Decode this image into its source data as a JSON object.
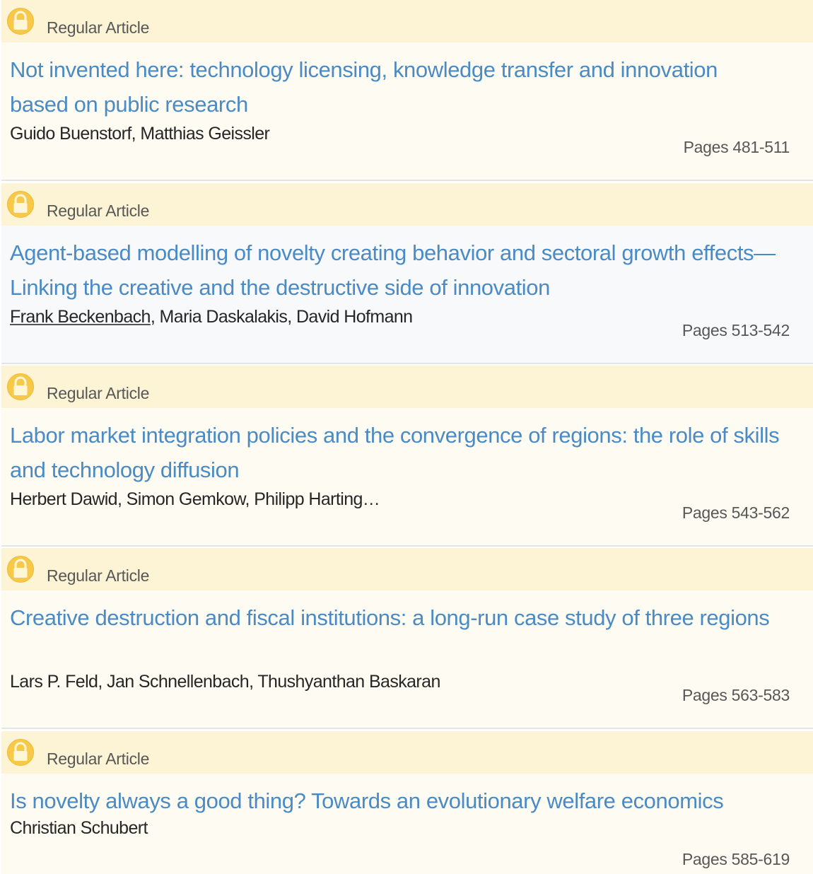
{
  "colors": {
    "header_background": "#fcf4d4",
    "item_background": "#fefcf2",
    "hovered_item_background": "#f8f9fb",
    "title_link": "#4a8ac5",
    "lock_icon": "#f7c94b",
    "divider": "#e4e4e4"
  },
  "articles": [
    {
      "type": "Regular Article",
      "title": "Not invented here: technology licensing, knowledge transfer and innovation based on public research",
      "authors": "Guido Buenstorf, Matthias Geissler",
      "pages": "Pages 481-511",
      "access_icon": "lock-icon"
    },
    {
      "type": "Regular Article",
      "title": "Agent-based modelling of novelty creating behavior and sectoral growth effects—Linking the creative and the destructive side of innovation",
      "authors_linked": "Frank Beckenbach",
      "authors_rest": ", Maria Daskalakis, David Hofmann",
      "pages": "Pages 513-542",
      "access_icon": "lock-icon"
    },
    {
      "type": "Regular Article",
      "title": "Labor market integration policies and the convergence of regions: the role of skills and technology diffusion",
      "authors": "Herbert Dawid, Simon Gemkow, Philipp Harting…",
      "pages": "Pages 543-562",
      "access_icon": "lock-icon"
    },
    {
      "type": "Regular Article",
      "title": "Creative destruction and fiscal institutions: a long-run case study of three regions",
      "authors": "Lars P. Feld, Jan Schnellenbach, Thushyanthan Baskaran",
      "pages": "Pages 563-583",
      "access_icon": "lock-icon"
    },
    {
      "type": "Regular Article",
      "title": "Is novelty always a good thing? Towards an evolutionary welfare economics",
      "authors": "Christian Schubert",
      "pages": "Pages 585-619",
      "access_icon": "lock-icon"
    }
  ]
}
